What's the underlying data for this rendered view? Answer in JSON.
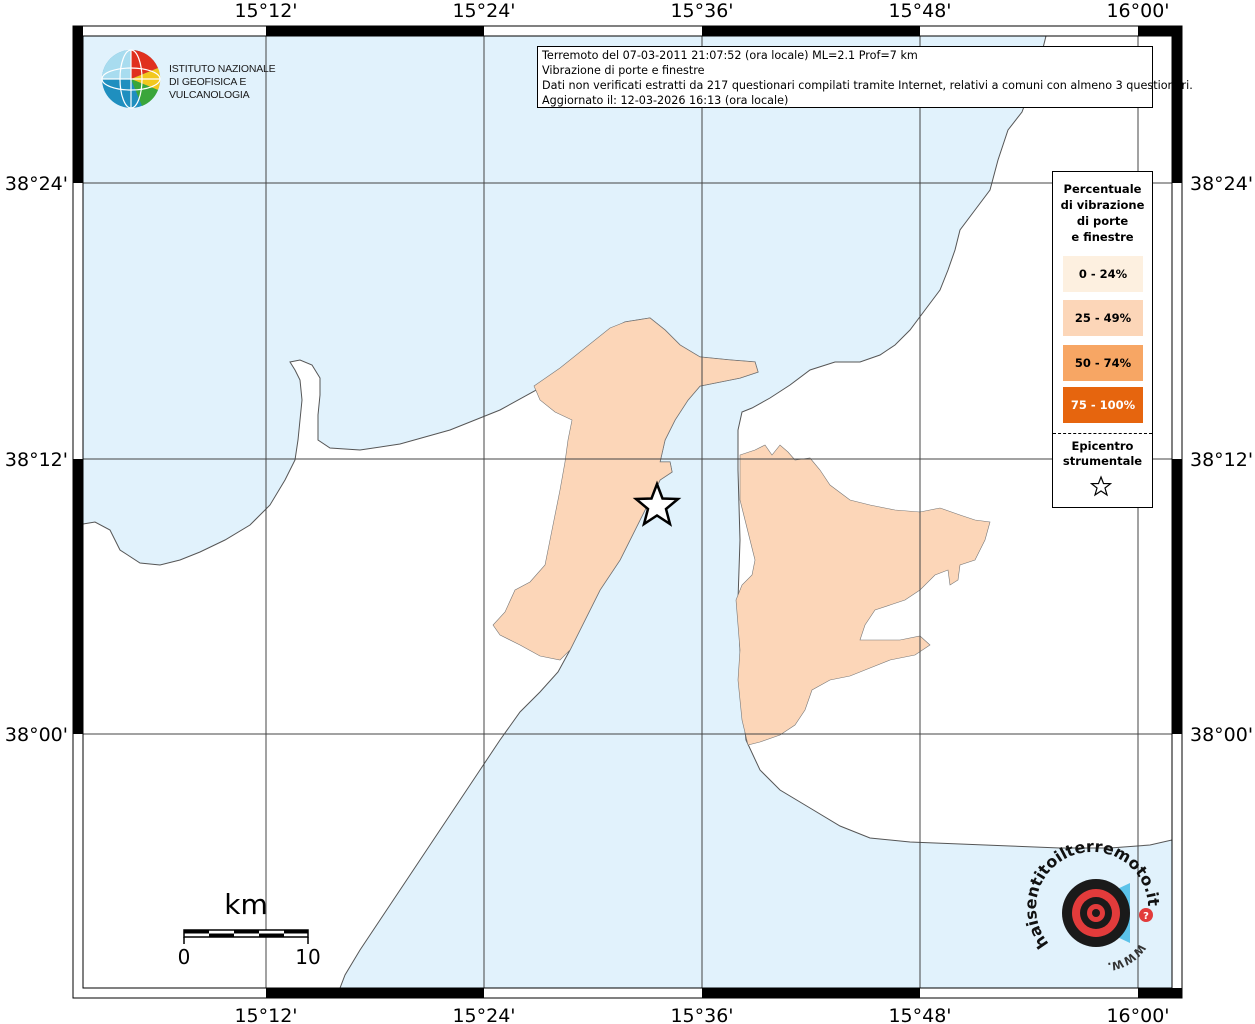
{
  "header": {
    "line1": "Terremoto del 07-03-2011 21:07:52 (ora locale) ML=2.1 Prof=7 km",
    "line2": "Vibrazione di porte e finestre",
    "line3": "Dati non verificati estratti da 217 questionari compilati tramite Internet, relativi a comuni con almeno 3 questionari.",
    "line4": "Aggiornato il: 12-03-2026 16:13 (ora locale)"
  },
  "logo": {
    "line1": "ISTITUTO NAZIONALE",
    "line2": "DI GEOFISICA E VULCANOLOGIA",
    "icon": "ingv-globe-icon"
  },
  "legend": {
    "title_lines": [
      "Percentuale",
      "di vibrazione",
      "di porte",
      "e finestre"
    ],
    "classes": [
      {
        "label": "0 - 24%",
        "color": "#fdf0e0",
        "text_color": "#000000"
      },
      {
        "label": "25 - 49%",
        "color": "#fcd6b8",
        "text_color": "#000000"
      },
      {
        "label": "50 - 74%",
        "color": "#f7a664",
        "text_color": "#000000"
      },
      {
        "label": "75 - 100%",
        "color": "#e6650e",
        "text_color": "#ffffff"
      }
    ],
    "epicenter_lines": [
      "Epicentro",
      "strumentale"
    ],
    "epicenter_icon": "star-icon"
  },
  "axes": {
    "lon_labels": [
      "15°12'",
      "15°24'",
      "15°36'",
      "15°48'",
      "16°00'"
    ],
    "lat_labels": [
      "38°24'",
      "38°12'",
      "38°00'"
    ]
  },
  "scalebar": {
    "unit": "km",
    "min": "0",
    "max": "10"
  },
  "badge": {
    "text": "haisentitoilterremoto.it",
    "url_text": "WWW.",
    "icon": "hsit-target-icon"
  },
  "colors": {
    "sea": "#e1f2fc",
    "land": "#ffffff",
    "coast": "#555555"
  },
  "chart_data": {
    "type": "map",
    "title": "Terremoto del 07-03-2011 21:07:52 (ora locale) ML=2.1 Prof=7 km",
    "lon_range": [
      "15°07'",
      "16°01'"
    ],
    "lat_range": [
      "37°50'",
      "38°30'"
    ],
    "epicenter": {
      "lon": "15°34'",
      "lat": "38°10'"
    },
    "municipalities": [
      {
        "region": "Messina area (Sicilia)",
        "class": "25 - 49%"
      },
      {
        "region": "Reggio Calabria area (Calabria)",
        "class": "25 - 49%"
      }
    ]
  }
}
